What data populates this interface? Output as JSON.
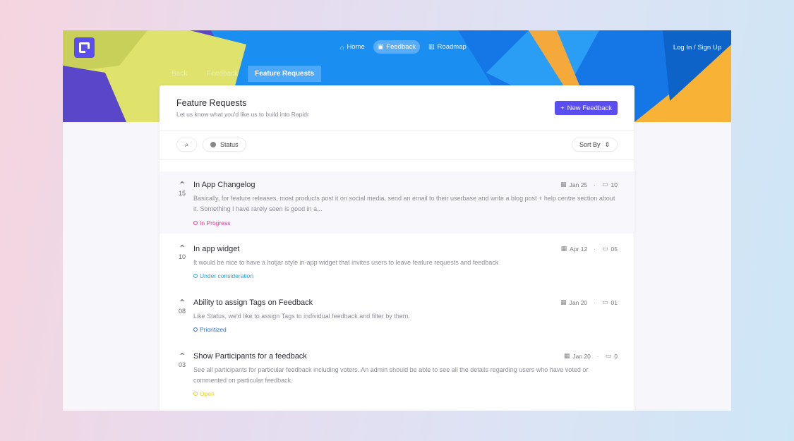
{
  "header": {
    "nav": [
      {
        "label": "Home",
        "icon": "home-icon",
        "glyph": "⌂"
      },
      {
        "label": "Feedback",
        "icon": "feedback-icon",
        "glyph": "▣"
      },
      {
        "label": "Roadmap",
        "icon": "map-icon",
        "glyph": "▥"
      }
    ],
    "login": "Log In / Sign Up"
  },
  "breadcrumb": [
    "Back",
    "Feedback",
    "Feature Requests"
  ],
  "page": {
    "title": "Feature Requests",
    "subtitle": "Let us know what you'd like us to build into Rapidr",
    "new_button": "New Feedback"
  },
  "toolbar": {
    "status_label": "Status",
    "sort_label": "Sort By"
  },
  "items": [
    {
      "votes": "15",
      "title": "In App Changelog",
      "desc": "Basically, for feature releases, most products post it on social media, send an email to their userbase and write a blog post + help centre section about it. Something I have rarely seen is good in a...",
      "status": "In Progress",
      "status_color": "#e23c8f",
      "date": "Jan 25",
      "comments": "10"
    },
    {
      "votes": "10",
      "title": "In app widget",
      "desc": "It would be nice to have a hotjar style in-app widget that invites users to leave feature requests and feedback",
      "status": "Under consideration",
      "status_color": "#26a0da",
      "date": "Apr 12",
      "comments": "05"
    },
    {
      "votes": "08",
      "title": "Ability to assign Tags on Feedback",
      "desc": "Like Status, we'd like to assign Tags to individual feedback and filter by them.",
      "status": "Prioritized",
      "status_color": "#2f6fd6",
      "date": "Jan 20",
      "comments": "01"
    },
    {
      "votes": "03",
      "title": "Show Participants for a feedback",
      "desc": "See all participants for particular feedback including voters. An admin should be able to see all the details regarding users who have voted or commented on particular feedback.",
      "status": "Open",
      "status_color": "#e8cc1e",
      "date": "Jan 20",
      "comments": "0"
    }
  ]
}
